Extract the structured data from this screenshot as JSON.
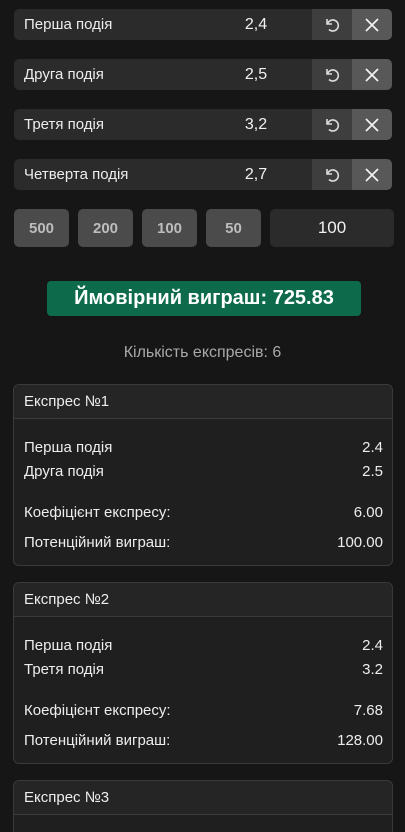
{
  "events": [
    {
      "name": "Перша подія",
      "odds": "2,4"
    },
    {
      "name": "Друга подія",
      "odds": "2,5"
    },
    {
      "name": "Третя подія",
      "odds": "3,2"
    },
    {
      "name": "Четверта подія",
      "odds": "2,7"
    }
  ],
  "icons": {
    "undo": "undo-icon",
    "close": "close-icon"
  },
  "stake": {
    "presets": [
      "500",
      "200",
      "100",
      "50"
    ],
    "value": "100"
  },
  "win_badge": "Ймовірний виграш: 725.83",
  "express_count": "Кількість експресів: 6",
  "cards": [
    {
      "title": "Експрес №1",
      "lines": [
        {
          "label": "Перша подія",
          "value": "2.4"
        },
        {
          "label": "Друга подія",
          "value": "2.5"
        }
      ],
      "coef_label": "Коефіцієнт експресу:",
      "coef": "6.00",
      "win_label": "Потенційний виграш:",
      "win": "100.00"
    },
    {
      "title": "Експрес №2",
      "lines": [
        {
          "label": "Перша подія",
          "value": "2.4"
        },
        {
          "label": "Третя подія",
          "value": "3.2"
        }
      ],
      "coef_label": "Коефіцієнт експресу:",
      "coef": "7.68",
      "win_label": "Потенційний виграш:",
      "win": "128.00"
    },
    {
      "title": "Експрес №3"
    }
  ],
  "colors": {
    "accent_green": "#0d6b4c",
    "background": "#161616"
  }
}
